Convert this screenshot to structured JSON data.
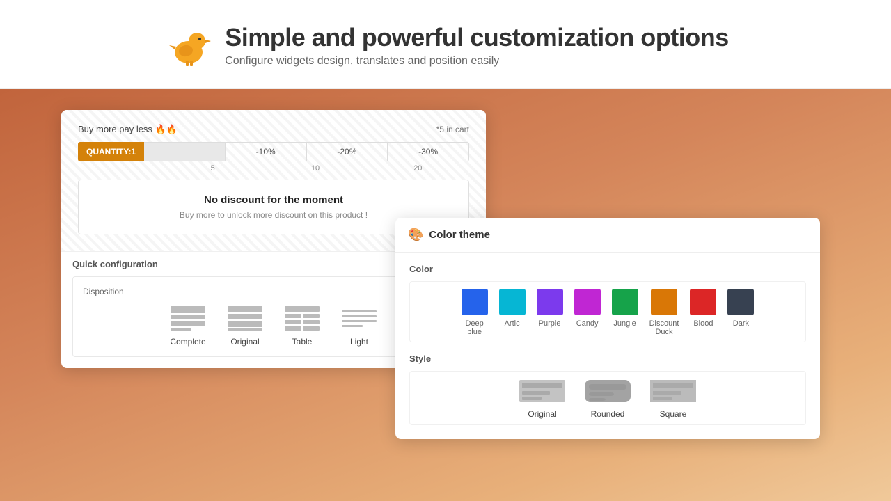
{
  "header": {
    "title": "Simple and powerful customization options",
    "subtitle": "Configure widgets design, translates and position easily"
  },
  "widget": {
    "buy_more_text": "Buy more pay less 🔥🔥",
    "cart_text": "*5 in cart",
    "qty_label": "QUANTITY:1",
    "segments": [
      "-10%",
      "-20%",
      "-30%"
    ],
    "qty_numbers": [
      "5",
      "10",
      "20"
    ],
    "no_discount_title": "No discount for the moment",
    "no_discount_body": "Buy more to unlock more discount on this product !"
  },
  "quick_config": {
    "title": "Quick configuration",
    "disposition_label": "Disposition",
    "options": [
      {
        "label": "Complete",
        "id": "complete"
      },
      {
        "label": "Original",
        "id": "original"
      },
      {
        "label": "Table",
        "id": "table"
      },
      {
        "label": "Light",
        "id": "light"
      }
    ]
  },
  "color_theme": {
    "title": "Color theme",
    "color_section_label": "Color",
    "colors": [
      {
        "name": "Deep blue",
        "hex": "#2563eb"
      },
      {
        "name": "Artic",
        "hex": "#06b6d4"
      },
      {
        "name": "Purple",
        "hex": "#7c3aed"
      },
      {
        "name": "Candy",
        "hex": "#c026d3"
      },
      {
        "name": "Jungle",
        "hex": "#16a34a"
      },
      {
        "name": "Discount Duck",
        "hex": "#d97706"
      },
      {
        "name": "Blood",
        "hex": "#dc2626"
      },
      {
        "name": "Dark",
        "hex": "#374151"
      }
    ],
    "style_section_label": "Style",
    "styles": [
      {
        "label": "Original",
        "id": "original"
      },
      {
        "label": "Rounded",
        "id": "rounded"
      },
      {
        "label": "Square",
        "id": "square"
      }
    ]
  }
}
